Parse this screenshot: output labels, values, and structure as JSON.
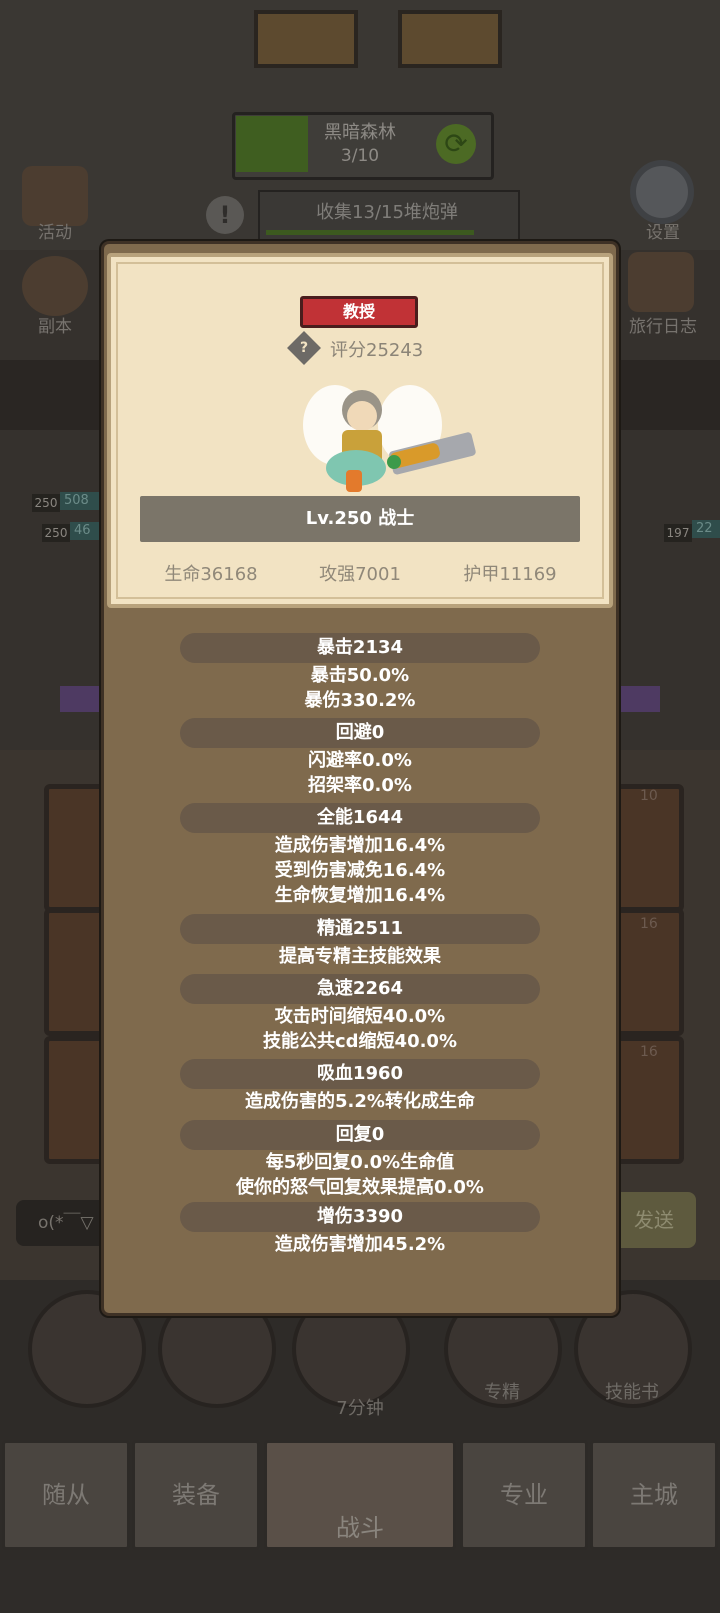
{
  "background": {
    "region": {
      "name": "黑暗森林",
      "progress": "3/10"
    },
    "quest": "收集13/15堆炮弹",
    "left_menu": [
      {
        "label": "活动"
      },
      {
        "label": "副本"
      }
    ],
    "right_menu": [
      {
        "label": "设置"
      },
      {
        "label": "旅行日志"
      }
    ],
    "hp_badges": [
      "250",
      "508",
      "250",
      "46",
      "197",
      "22"
    ],
    "card_counts": [
      "10",
      "16",
      "16"
    ],
    "chat_text": "o(*￣▽",
    "send_label": "发送",
    "bottom_buttons": [
      {
        "label": "7分钟"
      },
      {
        "label": "专精"
      },
      {
        "label": "技能书"
      }
    ],
    "nav_tabs": [
      {
        "label": "随从"
      },
      {
        "label": "装备"
      },
      {
        "label": "战斗"
      },
      {
        "label": "专业"
      },
      {
        "label": "主城"
      }
    ]
  },
  "popup": {
    "rank": "教授",
    "score": "评分25243",
    "level": "Lv.250 战士",
    "stats": {
      "hp": "生命36168",
      "attack": "攻强7001",
      "armor": "护甲11169"
    },
    "categories": [
      {
        "title": "暴击2134",
        "lines": [
          "暴击50.0%",
          "暴伤330.2%"
        ]
      },
      {
        "title": "回避0",
        "lines": [
          "闪避率0.0%",
          "招架率0.0%"
        ]
      },
      {
        "title": "全能1644",
        "lines": [
          "造成伤害增加16.4%",
          "受到伤害减免16.4%",
          "生命恢复增加16.4%"
        ]
      },
      {
        "title": "精通2511",
        "lines": [
          "提高专精主技能效果"
        ]
      },
      {
        "title": "急速2264",
        "lines": [
          "攻击时间缩短40.0%",
          "技能公共cd缩短40.0%"
        ]
      },
      {
        "title": "吸血1960",
        "lines": [
          "造成伤害的5.2%转化成生命"
        ]
      },
      {
        "title": "回复0",
        "lines": [
          "每5秒回复0.0%生命值",
          "使你的怒气回复效果提高0.0%"
        ]
      },
      {
        "title": "增伤3390",
        "lines": [
          "造成伤害增加45.2%"
        ]
      }
    ]
  },
  "colors": {
    "rank_badge": "#c13236",
    "popup_body": "#7f6a4d",
    "card_panel": "#f2e3c3"
  },
  "icons": [
    "refresh-icon",
    "alert-icon",
    "gear-icon",
    "question-icon",
    "hero-sprite"
  ]
}
